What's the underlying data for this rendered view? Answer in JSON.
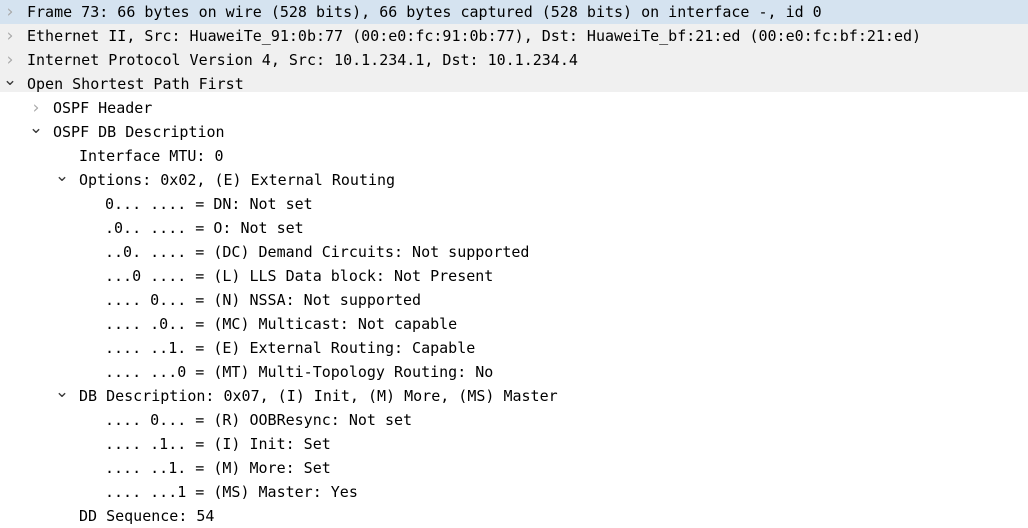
{
  "pane": {
    "name": "packet-details-tree",
    "background": "#ffffff",
    "toplevel_band_color": "#f0f0f0",
    "selection_color": "#d5e3f0",
    "text_color": "#000000",
    "collapsed_icon": "chevron-right-icon",
    "expanded_icon": "chevron-down-icon"
  },
  "tree": [
    {
      "label": "Frame 73: 66 bytes on wire (528 bits), 66 bytes captured (528 bits) on interface -, id 0",
      "depth": 0,
      "state": "collapsed",
      "selected": true,
      "name": "tree-item-frame"
    },
    {
      "label": "Ethernet II, Src: HuaweiTe_91:0b:77 (00:e0:fc:91:0b:77), Dst: HuaweiTe_bf:21:ed (00:e0:fc:bf:21:ed)",
      "depth": 0,
      "state": "collapsed",
      "selected": false,
      "name": "tree-item-ethernet"
    },
    {
      "label": "Internet Protocol Version 4, Src: 10.1.234.1, Dst: 10.1.234.4",
      "depth": 0,
      "state": "collapsed",
      "selected": false,
      "name": "tree-item-ipv4"
    },
    {
      "label": "Open Shortest Path First",
      "depth": 0,
      "state": "expanded",
      "selected": false,
      "name": "tree-item-ospf"
    },
    {
      "label": "OSPF Header",
      "depth": 1,
      "state": "collapsed",
      "selected": false,
      "name": "tree-item-ospf-header"
    },
    {
      "label": "OSPF DB Description",
      "depth": 1,
      "state": "expanded",
      "selected": false,
      "name": "tree-item-ospf-db-description"
    },
    {
      "label": "Interface MTU: 0",
      "depth": 2,
      "state": "leaf",
      "selected": false,
      "name": "tree-item-interface-mtu"
    },
    {
      "label": "Options: 0x02, (E) External Routing",
      "depth": 2,
      "state": "expanded",
      "selected": false,
      "name": "tree-item-options"
    },
    {
      "label": "0... .... = DN: Not set",
      "depth": 3,
      "state": "leaf",
      "selected": false,
      "name": "tree-item-flag-dn"
    },
    {
      "label": ".0.. .... = O: Not set",
      "depth": 3,
      "state": "leaf",
      "selected": false,
      "name": "tree-item-flag-o"
    },
    {
      "label": "..0. .... = (DC) Demand Circuits: Not supported",
      "depth": 3,
      "state": "leaf",
      "selected": false,
      "name": "tree-item-flag-dc"
    },
    {
      "label": "...0 .... = (L) LLS Data block: Not Present",
      "depth": 3,
      "state": "leaf",
      "selected": false,
      "name": "tree-item-flag-l"
    },
    {
      "label": ".... 0... = (N) NSSA: Not supported",
      "depth": 3,
      "state": "leaf",
      "selected": false,
      "name": "tree-item-flag-n"
    },
    {
      "label": ".... .0.. = (MC) Multicast: Not capable",
      "depth": 3,
      "state": "leaf",
      "selected": false,
      "name": "tree-item-flag-mc"
    },
    {
      "label": ".... ..1. = (E) External Routing: Capable",
      "depth": 3,
      "state": "leaf",
      "selected": false,
      "name": "tree-item-flag-e"
    },
    {
      "label": ".... ...0 = (MT) Multi-Topology Routing: No",
      "depth": 3,
      "state": "leaf",
      "selected": false,
      "name": "tree-item-flag-mt"
    },
    {
      "label": "DB Description: 0x07, (I) Init, (M) More, (MS) Master",
      "depth": 2,
      "state": "expanded",
      "selected": false,
      "name": "tree-item-db-description"
    },
    {
      "label": ".... 0... = (R) OOBResync: Not set",
      "depth": 3,
      "state": "leaf",
      "selected": false,
      "name": "tree-item-flag-r"
    },
    {
      "label": ".... .1.. = (I) Init: Set",
      "depth": 3,
      "state": "leaf",
      "selected": false,
      "name": "tree-item-flag-i"
    },
    {
      "label": ".... ..1. = (M) More: Set",
      "depth": 3,
      "state": "leaf",
      "selected": false,
      "name": "tree-item-flag-m"
    },
    {
      "label": ".... ...1 = (MS) Master: Yes",
      "depth": 3,
      "state": "leaf",
      "selected": false,
      "name": "tree-item-flag-ms"
    },
    {
      "label": "DD Sequence: 54",
      "depth": 2,
      "state": "leaf",
      "selected": false,
      "name": "tree-item-dd-sequence"
    }
  ]
}
